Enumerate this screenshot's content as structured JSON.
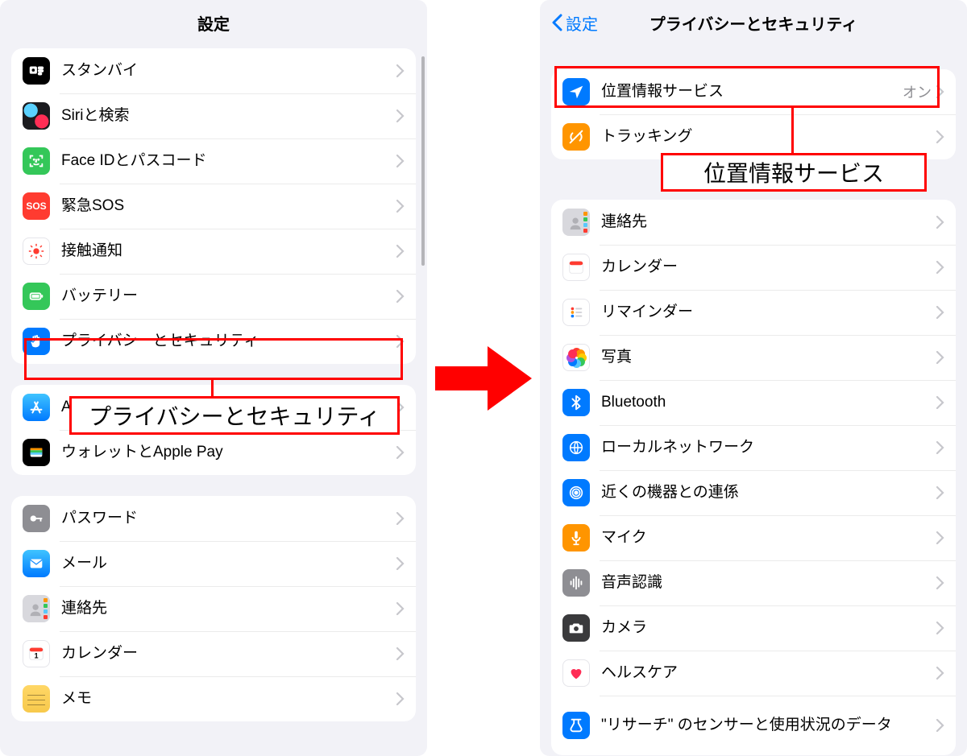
{
  "left": {
    "title": "設定",
    "group1": [
      {
        "key": "standby",
        "label": "スタンバイ"
      },
      {
        "key": "siri",
        "label": "Siriと検索"
      },
      {
        "key": "faceid",
        "label": "Face IDとパスコード"
      },
      {
        "key": "sos",
        "label": "緊急SOS"
      },
      {
        "key": "exposure",
        "label": "接触通知"
      },
      {
        "key": "battery",
        "label": "バッテリー"
      },
      {
        "key": "privacy",
        "label": "プライバシーとセキュリティ"
      }
    ],
    "group2": [
      {
        "key": "appstore",
        "label": "App Store"
      },
      {
        "key": "wallet",
        "label": "ウォレットとApple Pay"
      }
    ],
    "group3": [
      {
        "key": "passwords",
        "label": "パスワード"
      },
      {
        "key": "mail",
        "label": "メール"
      },
      {
        "key": "contacts",
        "label": "連絡先"
      },
      {
        "key": "calendar",
        "label": "カレンダー"
      },
      {
        "key": "notes",
        "label": "メモ"
      }
    ],
    "highlight_callout": "プライバシーとセキュリティ"
  },
  "right": {
    "back_label": "設定",
    "title": "プライバシーとセキュリティ",
    "group1": [
      {
        "key": "location",
        "label": "位置情報サービス",
        "detail": "オン"
      },
      {
        "key": "tracking",
        "label": "トラッキング"
      }
    ],
    "group2": [
      {
        "key": "contacts",
        "label": "連絡先"
      },
      {
        "key": "calendar",
        "label": "カレンダー"
      },
      {
        "key": "reminders",
        "label": "リマインダー"
      },
      {
        "key": "photos",
        "label": "写真"
      },
      {
        "key": "bluetooth",
        "label": "Bluetooth"
      },
      {
        "key": "localnet",
        "label": "ローカルネットワーク"
      },
      {
        "key": "nearby",
        "label": "近くの機器との連係"
      },
      {
        "key": "mic",
        "label": "マイク"
      },
      {
        "key": "speech",
        "label": "音声認識"
      },
      {
        "key": "camera",
        "label": "カメラ"
      },
      {
        "key": "health",
        "label": "ヘルスケア"
      },
      {
        "key": "research",
        "label": "\"リサーチ\" のセンサーと使用状況のデータ"
      }
    ],
    "highlight_callout": "位置情報サービス"
  }
}
